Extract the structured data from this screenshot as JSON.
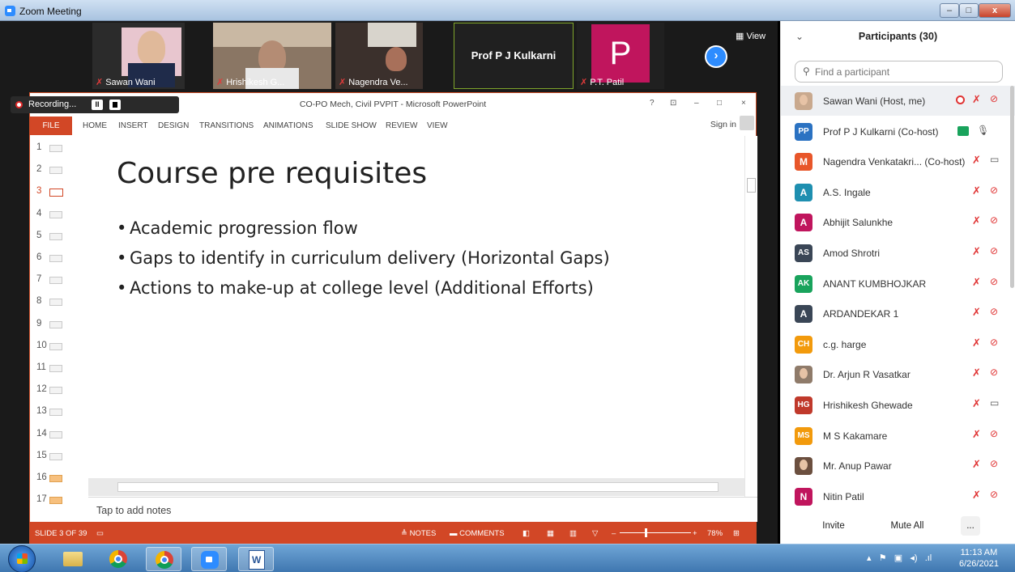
{
  "window": {
    "title": "Zoom Meeting"
  },
  "gallery": {
    "tiles": [
      {
        "name": "Sawan Wani"
      },
      {
        "name": "Hrishikesh G..."
      },
      {
        "name": "Nagendra Ve..."
      },
      {
        "name": "Prof P J Kulkarni"
      },
      {
        "name": "P.T. Patil",
        "initial": "P",
        "color": "#c0155d"
      }
    ],
    "view_label": "View"
  },
  "recording": {
    "label": "Recording..."
  },
  "ppt": {
    "doc_title": "CO-PO Mech, Civil PVPIT - Microsoft PowerPoint",
    "caption_buttons": [
      "?",
      "⊡",
      "–",
      "□",
      "×"
    ],
    "file_tab": "FILE",
    "tabs": [
      "HOME",
      "INSERT",
      "DESIGN",
      "TRANSITIONS",
      "ANIMATIONS",
      "SLIDE SHOW",
      "REVIEW",
      "VIEW"
    ],
    "sign_in": "Sign in",
    "slide_numbers": [
      "1",
      "2",
      "3",
      "4",
      "5",
      "6",
      "7",
      "8",
      "9",
      "10",
      "11",
      "12",
      "13",
      "14",
      "15",
      "16",
      "17"
    ],
    "current_slide_index": 3,
    "slide": {
      "title": "Course pre requisites",
      "bullets": [
        "Academic progression flow",
        "Gaps to identify in curriculum delivery (Horizontal Gaps)",
        "Actions to make-up at college level (Additional Efforts)"
      ]
    },
    "notes_placeholder": "Tap to add notes",
    "status": {
      "slide_counter": "SLIDE 3 OF 39",
      "notes": "NOTES",
      "comments": "COMMENTS",
      "zoom": "78%"
    }
  },
  "participants": {
    "header": "Participants (30)",
    "search_placeholder": "Find a participant",
    "list": [
      {
        "name": "Sawan Wani (Host, me)",
        "avatar": "",
        "color": "#c9a98e",
        "recording": true
      },
      {
        "name": "Prof P J Kulkarni (Co-host)",
        "avatar": "PP",
        "color": "#2b72c2",
        "audio_on": true
      },
      {
        "name": "Nagendra Venkatakri... (Co-host)",
        "avatar": "M",
        "color": "#e8562a"
      },
      {
        "name": "A.S. Ingale",
        "avatar": "A",
        "color": "#1e8fb0"
      },
      {
        "name": "Abhijit Salunkhe",
        "avatar": "A",
        "color": "#c0155d"
      },
      {
        "name": "Amod Shrotri",
        "avatar": "AS",
        "color": "#3a4656"
      },
      {
        "name": "ANANT KUMBHOJKAR",
        "avatar": "AK",
        "color": "#19a35c"
      },
      {
        "name": "ARDANDEKAR 1",
        "avatar": "A",
        "color": "#3a4656"
      },
      {
        "name": "c.g. harge",
        "avatar": "CH",
        "color": "#f29a0c"
      },
      {
        "name": "Dr. Arjun R Vasatkar",
        "avatar": "",
        "color": "#8f7b6a"
      },
      {
        "name": "Hrishikesh Ghewade",
        "avatar": "HG",
        "color": "#c0392b"
      },
      {
        "name": "M S Kakamare",
        "avatar": "MS",
        "color": "#f29a0c"
      },
      {
        "name": "Mr. Anup Pawar",
        "avatar": "",
        "color": "#6b4f3f"
      },
      {
        "name": "Nitin Patil",
        "avatar": "N",
        "color": "#c0155d"
      }
    ],
    "buttons": {
      "invite": "Invite",
      "mute_all": "Mute All",
      "more": "..."
    }
  },
  "taskbar": {
    "time": "11:13 AM",
    "date": "6/26/2021"
  }
}
